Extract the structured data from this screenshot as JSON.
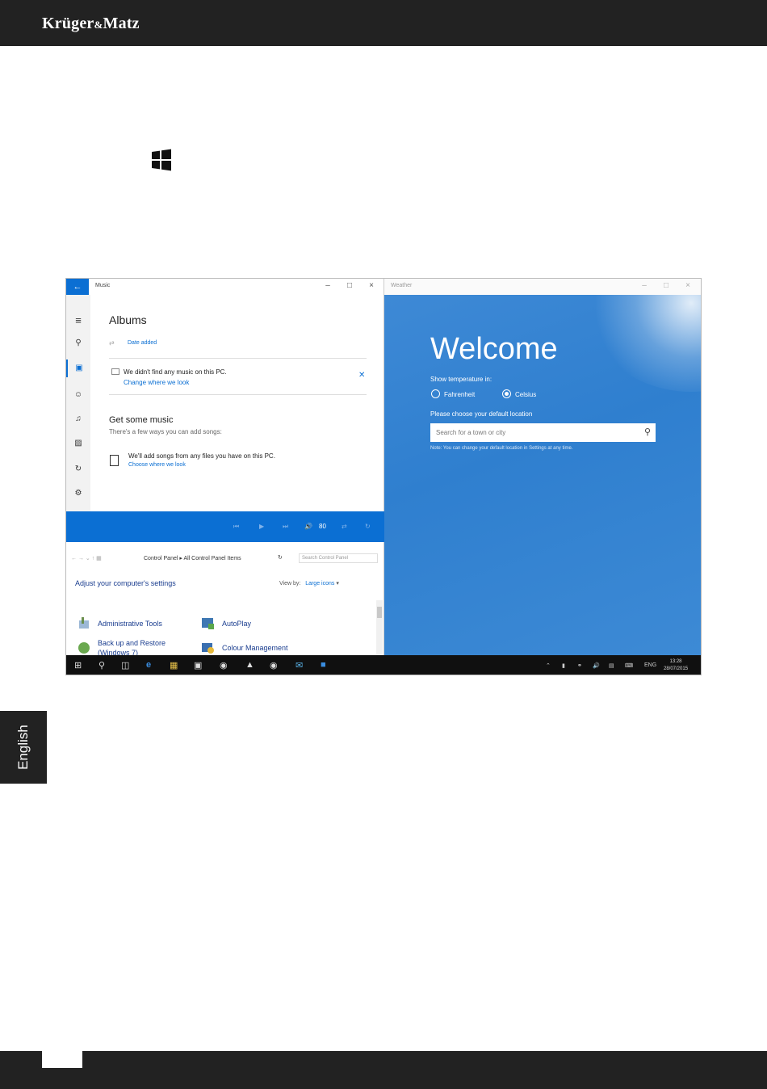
{
  "header": {
    "brand": "Krüger",
    "brand_amp": "&",
    "brand_tail": "Matz"
  },
  "side_tab": {
    "language": "English"
  },
  "music": {
    "window_title": "Music",
    "back_icon": "arrow-left-icon",
    "heading": "Albums",
    "sort": "Date added",
    "no_music": "We didn't find any music on this PC.",
    "change_link": "Change where we look",
    "get_some": "Get some music",
    "ways": "There's a few ways you can add songs:",
    "add_songs": "We'll add songs from any files you have on this PC.",
    "choose_link": "Choose where we look",
    "volume": "80"
  },
  "control_panel": {
    "path1": "Control Panel",
    "path2": "All Control Panel Items",
    "search_placeholder": "Search Control Panel",
    "adjust": "Adjust your computer's settings",
    "view_by_label": "View by:",
    "view_by_value": "Large icons",
    "items": [
      "Administrative Tools",
      "AutoPlay",
      "Back up and Restore",
      "(Windows 7)",
      "Colour Management"
    ]
  },
  "weather": {
    "window_title": "Weather",
    "welcome": "Welcome",
    "show_temp": "Show temperature in:",
    "fahrenheit": "Fahrenheit",
    "celsius": "Celsius",
    "selected_unit": "Celsius",
    "default_location": "Please choose your default location",
    "search_placeholder": "Search for a town or city",
    "note": "Note: You can change your default location in Settings at any time."
  },
  "taskbar": {
    "language": "ENG",
    "time": "13:28",
    "date": "28/07/2015"
  },
  "colors": {
    "accent": "#0b6fd3",
    "bar": "#222222"
  }
}
